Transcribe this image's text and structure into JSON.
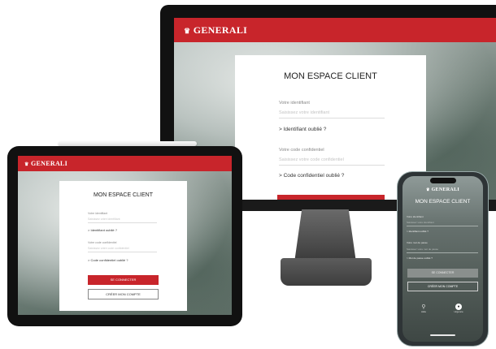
{
  "brand": {
    "logo_text": "GENERALI",
    "accent": "#c8252b"
  },
  "desktop": {
    "title": "MON ESPACE CLIENT",
    "id_label": "Votre identifiant",
    "id_placeholder": "Saisissez votre identifiant",
    "forgot_id": "Identifiant oublié ?",
    "code_label": "Votre code confidentiel",
    "code_placeholder": "Saisissez votre code confidentiel",
    "forgot_code": "Code confidentiel oublié ?"
  },
  "tablet": {
    "title": "MON ESPACE CLIENT",
    "id_label": "Votre identifiant",
    "id_placeholder": "Saisissez votre identifiant",
    "forgot_id": "Identifiant oublié ?",
    "code_label": "Votre code confidentiel",
    "code_placeholder": "Saisissez votre code confidentiel",
    "forgot_code": "Code confidentiel oublié ?",
    "connect_button": "SE CONNECTER",
    "create_button": "CRÉER MON COMPTE"
  },
  "phone": {
    "title": "MON ESPACE CLIENT",
    "id_label": "Votre identifiant",
    "id_placeholder": "Saisissez votre identifiant",
    "forgot_id": "Identifiant oublié ?",
    "code_label": "Votre mot de passe",
    "code_placeholder": "Saisissez votre mot de passe",
    "forgot_code": "Mot de passe oublié ?",
    "connect_button": "SE CONNECTER",
    "create_button": "CRÉER MON COMPTE",
    "nav_left": "Aide",
    "nav_right": "Urgence"
  }
}
